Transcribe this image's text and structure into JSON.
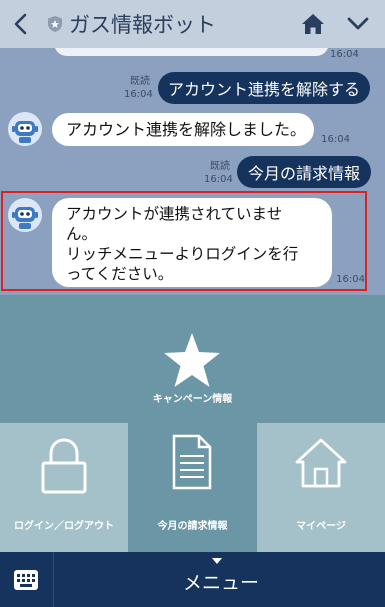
{
  "header": {
    "title": "ガス情報ボット"
  },
  "chat": {
    "top_time": "16:04",
    "messages": [
      {
        "from": "user",
        "read": "既読",
        "time": "16:04",
        "text": "アカウント連携を解除する"
      },
      {
        "from": "bot",
        "time": "16:04",
        "text": "アカウント連携を解除しました。"
      },
      {
        "from": "user",
        "read": "既読",
        "time": "16:04",
        "text": "今月の請求情報"
      },
      {
        "from": "bot",
        "time": "16:04",
        "lines": [
          "アカウントが連携されていませ",
          "ん。",
          "リッチメニューよりログインを行",
          "ってください。"
        ]
      }
    ]
  },
  "rich_menu": {
    "campaign_label": "キャンペーン情報",
    "login_label": "ログイン／ログアウト",
    "billing_label": "今月の請求情報",
    "mypage_label": "マイページ"
  },
  "bottom_bar": {
    "menu_label": "メニュー"
  },
  "colors": {
    "chat_bg": "#8ca1bf",
    "user_bubble": "#16335e",
    "menu_bg": "#6b96a6",
    "highlight": "#e02020"
  }
}
